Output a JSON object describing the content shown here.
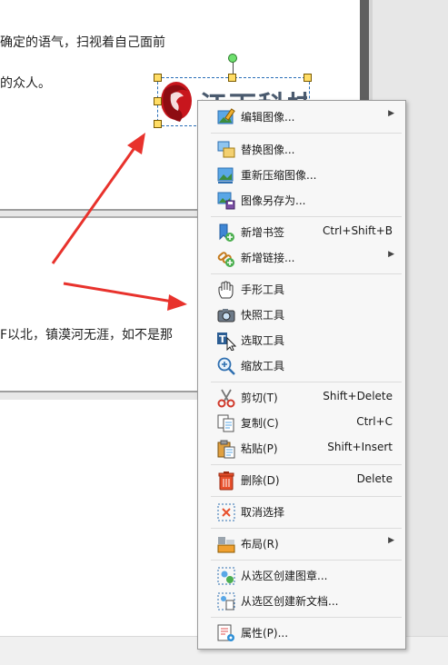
{
  "document": {
    "line1": "确定的语气，扫视着自己面前",
    "line2": "的众人。",
    "line3": "F以北，镇漠河无涯，如不是那",
    "logo_text": "江下科技"
  },
  "menu": {
    "items": [
      {
        "id": "edit-image",
        "label": "编辑图像...",
        "shortcut": "",
        "submenu": true,
        "icon": "edit-image-icon"
      },
      {
        "id": "replace-image",
        "label": "替换图像...",
        "shortcut": "",
        "submenu": false,
        "icon": "replace-image-icon"
      },
      {
        "id": "recompress-image",
        "label": "重新压缩图像...",
        "shortcut": "",
        "submenu": false,
        "icon": "compress-image-icon"
      },
      {
        "id": "save-image-as",
        "label": "图像另存为...",
        "shortcut": "",
        "submenu": false,
        "icon": "save-image-icon"
      },
      {
        "id": "add-bookmark",
        "label": "新增书签",
        "shortcut": "Ctrl+Shift+B",
        "submenu": false,
        "icon": "bookmark-add-icon"
      },
      {
        "id": "add-link",
        "label": "新增链接...",
        "shortcut": "",
        "submenu": true,
        "icon": "link-add-icon"
      },
      {
        "id": "hand-tool",
        "label": "手形工具",
        "shortcut": "",
        "submenu": false,
        "icon": "hand-icon"
      },
      {
        "id": "snapshot-tool",
        "label": "快照工具",
        "shortcut": "",
        "submenu": false,
        "icon": "camera-icon"
      },
      {
        "id": "select-tool",
        "label": "选取工具",
        "shortcut": "",
        "submenu": false,
        "icon": "text-select-icon"
      },
      {
        "id": "zoom-tool",
        "label": "缩放工具",
        "shortcut": "",
        "submenu": false,
        "icon": "zoom-icon"
      },
      {
        "id": "cut",
        "label": "剪切(T)",
        "shortcut": "Shift+Delete",
        "submenu": false,
        "icon": "scissors-icon"
      },
      {
        "id": "copy",
        "label": "复制(C)",
        "shortcut": "Ctrl+C",
        "submenu": false,
        "icon": "copy-icon"
      },
      {
        "id": "paste",
        "label": "粘贴(P)",
        "shortcut": "Shift+Insert",
        "submenu": false,
        "icon": "paste-icon"
      },
      {
        "id": "delete",
        "label": "删除(D)",
        "shortcut": "Delete",
        "submenu": false,
        "icon": "trash-icon"
      },
      {
        "id": "deselect",
        "label": "取消选择",
        "shortcut": "",
        "submenu": false,
        "icon": "deselect-icon"
      },
      {
        "id": "layout",
        "label": "布局(R)",
        "shortcut": "",
        "submenu": true,
        "icon": "layout-icon"
      },
      {
        "id": "create-stamp",
        "label": "从选区创建图章...",
        "shortcut": "",
        "submenu": false,
        "icon": "stamp-icon"
      },
      {
        "id": "create-document",
        "label": "从选区创建新文档...",
        "shortcut": "",
        "submenu": false,
        "icon": "new-document-icon"
      },
      {
        "id": "properties",
        "label": "属性(P)...",
        "shortcut": "",
        "submenu": false,
        "icon": "properties-icon"
      }
    ]
  },
  "colors": {
    "annotation_arrow": "#e8322c",
    "selection_border": "#2a6fb7",
    "menu_background": "#f7f7f7"
  }
}
